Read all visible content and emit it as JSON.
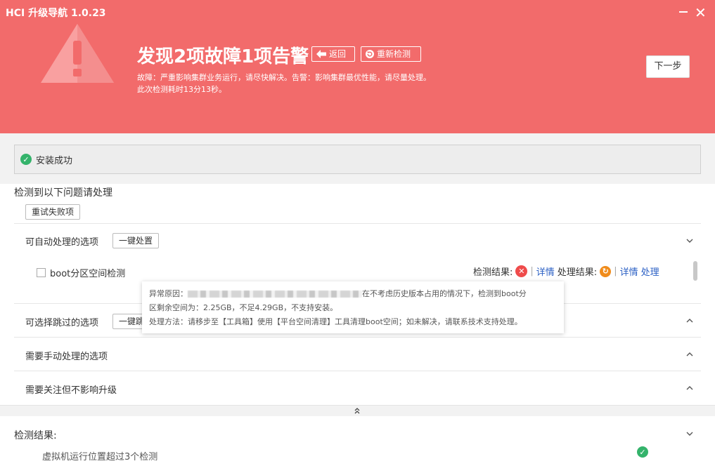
{
  "app": {
    "title": "HCI 升级导航 1.0.23"
  },
  "header": {
    "headline": "发现2项故障1项告警",
    "back_label": "返回",
    "recheck_label": "重新检测",
    "desc_line1": "故障：严重影响集群业务运行，请尽快解决。告警：影响集群最优性能，请尽量处理。",
    "desc_line2": "此次检测耗时13分13秒。",
    "next_label": "下一步"
  },
  "status": {
    "text": "安装成功"
  },
  "issues": {
    "title": "检测到以下问题请处理",
    "retry_label": "重试失败项",
    "groups": [
      {
        "label": "可自动处理的选项",
        "button": "一键处置",
        "expanded": true
      },
      {
        "label": "可选择跳过的选项",
        "button": "一键跳过",
        "expanded": false
      },
      {
        "label": "需要手动处理的选项",
        "expanded": false
      },
      {
        "label": "需要关注但不影响升级",
        "expanded": false
      }
    ],
    "item": {
      "label": "boot分区空间检测",
      "check_result_label": "检测结果:",
      "detail_label": "详情",
      "process_result_label": "处理结果:",
      "process_label": "处理"
    }
  },
  "tooltip": {
    "reason_prefix": "异常原因：",
    "reason_text": "在不考虑历史版本占用的情况下，检测到boot分",
    "reason_line2": "区剩余空间为：2.25GB，不足4.29GB，不支持安装。",
    "method_line": "处理方法：请移步至【工具箱】使用【平台空间清理】工具清理boot空间；如未解决，请联系技术支持处理。"
  },
  "results": {
    "title": "检测结果:",
    "items": [
      {
        "label": "虚拟机运行位置超过3个检测",
        "ok": true
      }
    ]
  },
  "colors": {
    "header_bg": "#f26b6b",
    "success": "#34b36b",
    "error": "#ef4b4b",
    "processing": "#f08c1c",
    "link": "#2a5fc4"
  }
}
